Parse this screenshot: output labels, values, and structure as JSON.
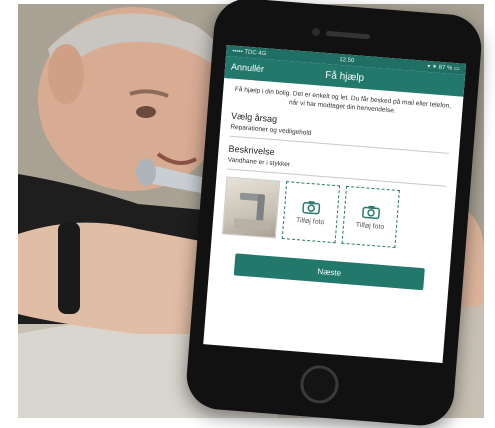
{
  "photo": {
    "description_icons": [
      "faucet-icon"
    ]
  },
  "phone": {
    "status": {
      "left": "••••• TDC 4G",
      "time": "12.50",
      "right": "▾ ⁕ 87 % ▭"
    },
    "header": {
      "cancel_label": "Annullér",
      "title": "Få hjælp"
    },
    "intro_text": "Få hjælp i din bolig. Det er enkelt og let. Du får besked på mail eller telefon, når vi har modtaget din henvendelse.",
    "cause": {
      "label": "Vælg årsag",
      "value": "Reparationer og vedligehold"
    },
    "description": {
      "label": "Beskrivelse",
      "value": "Vandhane er i stykker"
    },
    "photos": {
      "add_photo_label_1": "Tilføj foto",
      "add_photo_label_2": "Tilføj foto"
    },
    "next_label": "Næste"
  },
  "colors": {
    "accent": "#23786c",
    "status_bar": "#1f6f64"
  }
}
